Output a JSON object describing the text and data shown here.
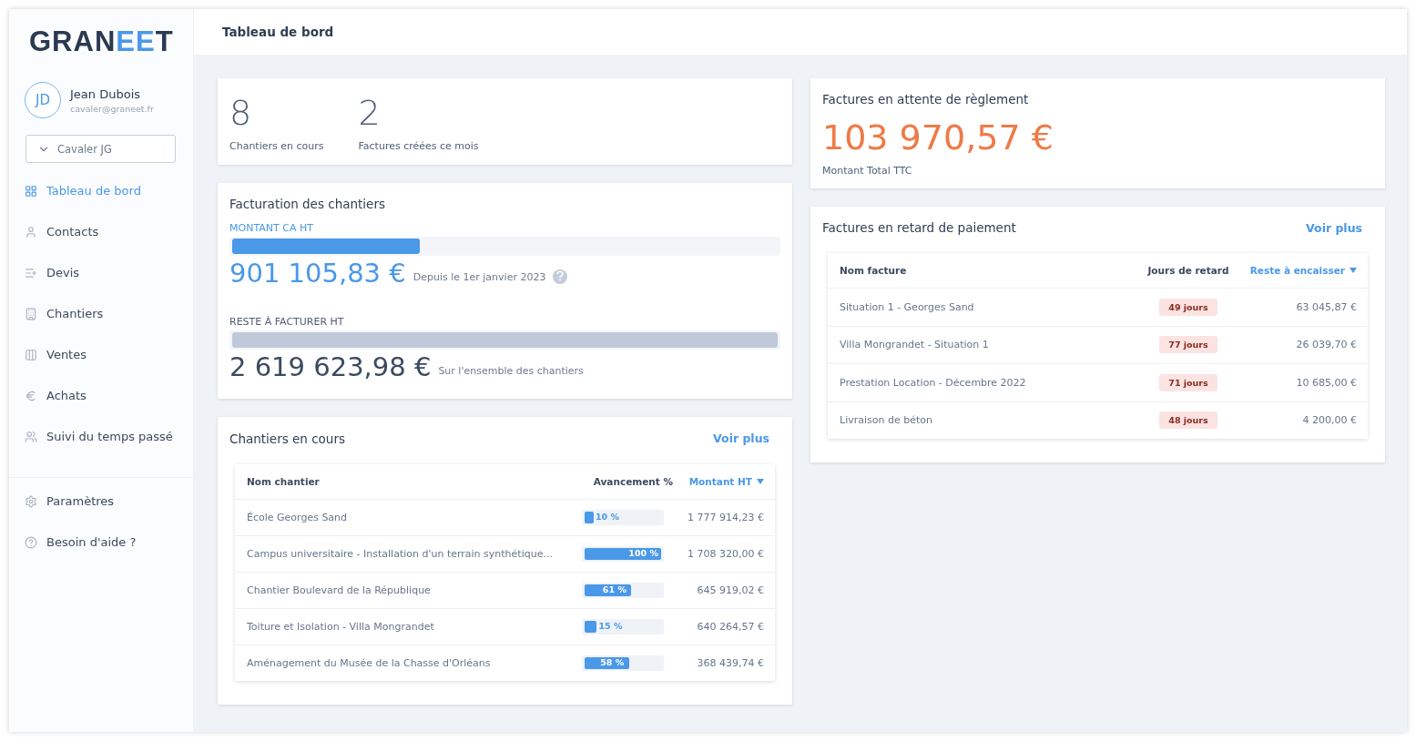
{
  "logo": [
    "GRAN",
    "EE",
    "T"
  ],
  "user": {
    "initials": "JD",
    "name": "Jean Dubois",
    "email": "cavaler@graneet.fr"
  },
  "company_select": {
    "value": "Cavaler JG"
  },
  "sidebar": {
    "items": [
      {
        "kind": "dashboard",
        "label": "Tableau de bord",
        "selected": true
      },
      {
        "kind": "contacts",
        "label": "Contacts",
        "selected": false
      },
      {
        "kind": "quotes",
        "label": "Devis",
        "selected": false
      },
      {
        "kind": "sites",
        "label": "Chantiers",
        "selected": false
      },
      {
        "kind": "sales",
        "label": "Ventes",
        "selected": false
      },
      {
        "kind": "purchases",
        "label": "Achats",
        "selected": false
      },
      {
        "kind": "time",
        "label": "Suivi du temps passé",
        "selected": false
      }
    ],
    "bottom_items": [
      {
        "kind": "settings",
        "label": "Paramètres",
        "selected": false
      },
      {
        "kind": "help",
        "label": "Besoin d'aide ?",
        "selected": false
      }
    ]
  },
  "header": {
    "title": "Tableau de bord"
  },
  "stats": [
    {
      "value": "8",
      "label": "Chantiers en cours"
    },
    {
      "value": "2",
      "label": "Factures créées ce mois"
    }
  ],
  "billing": {
    "title": "Facturation des chantiers",
    "invoiced": {
      "label": "MONTANT CA HT",
      "level": 0.344,
      "amount": "901 105,83 €",
      "note": "Depuis le 1er janvier 2023"
    },
    "remaining": {
      "label": "RESTE À FACTURER HT",
      "level": 1,
      "amount": "2 619 623,98 €",
      "note": "Sur l'ensemble des chantiers"
    }
  },
  "sites": {
    "title": "Chantiers en cours",
    "link": "Voir plus",
    "columns": [
      "Nom chantier",
      "Avancement %",
      "Montant HT"
    ],
    "rows": [
      {
        "name": "École Georges Sand",
        "level": 0.1,
        "progress": "10 %",
        "amount": "1 777 914,23 €"
      },
      {
        "name": "Campus universitaire - Installation d'un terrain synthétique...",
        "level": 1,
        "progress": "100 %",
        "amount": "1 708 320,00 €"
      },
      {
        "name": "Chantier Boulevard de la République",
        "level": 0.61,
        "progress": "61 %",
        "amount": "645 919,02 €"
      },
      {
        "name": "Toiture et Isolation - Villa Mongrandet",
        "level": 0.15,
        "progress": "15 %",
        "amount": "640 264,57 €"
      },
      {
        "name": "Aménagement du Musée de la Chasse d'Orléans",
        "level": 0.58,
        "progress": "58 %",
        "amount": "368 439,74 €"
      }
    ]
  },
  "pending": {
    "title": "Factures en attente de règlement",
    "amount": "103 970,57 €",
    "label": "Montant Total TTC"
  },
  "late": {
    "title": "Factures en retard de paiement",
    "link": "Voir plus",
    "columns": [
      "Nom facture",
      "Jours de retard",
      "Reste à encaisser"
    ],
    "rows": [
      {
        "name": "Situation 1 - Georges Sand",
        "delay": "49 jours",
        "amount": "63 045,87 €"
      },
      {
        "name": "Villa Mongrandet - Situation 1",
        "delay": "77 jours",
        "amount": "26 039,70 €"
      },
      {
        "name": "Prestation Location - Décembre 2022",
        "delay": "71 jours",
        "amount": "10 685,00 €"
      },
      {
        "name": "Livraison de béton",
        "delay": "48 jours",
        "amount": "4 200,00 €"
      }
    ]
  }
}
